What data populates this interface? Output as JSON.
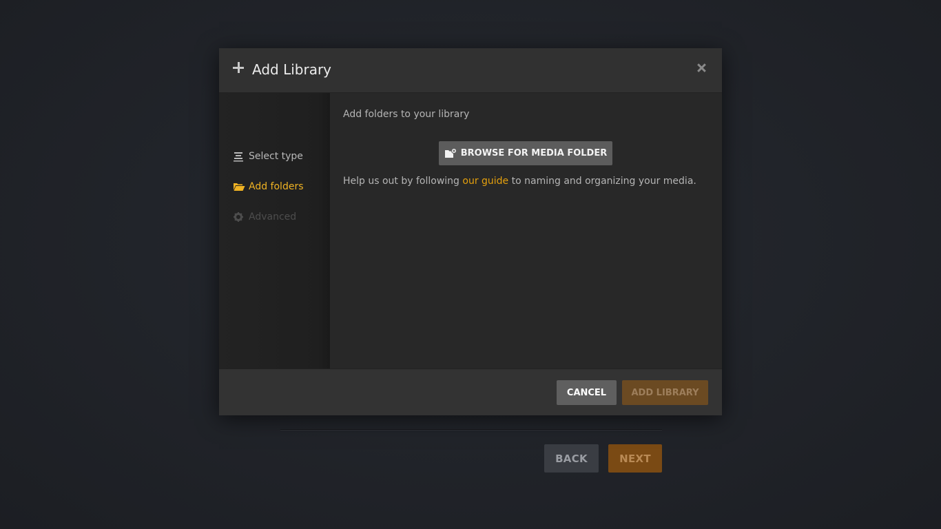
{
  "background": {
    "back_label": "BACK",
    "next_label": "NEXT"
  },
  "modal": {
    "title": "Add Library",
    "sidebar": {
      "items": [
        {
          "label": "Select type",
          "icon": "list-icon",
          "state": "completed"
        },
        {
          "label": "Add folders",
          "icon": "folder-open-icon",
          "state": "active"
        },
        {
          "label": "Advanced",
          "icon": "gear-icon",
          "state": "disabled"
        }
      ]
    },
    "content": {
      "heading": "Add folders to your library",
      "browse_label": "BROWSE FOR MEDIA FOLDER",
      "help_prefix": "Help us out by following ",
      "help_link": "our guide",
      "help_suffix": " to naming and organizing your media."
    },
    "footer": {
      "cancel_label": "CANCEL",
      "add_library_label": "ADD LIBRARY"
    }
  },
  "colors": {
    "accent": "#e5a00d",
    "active_nav": "#f0b323",
    "modal_bg": "#282828",
    "page_bg": "#22252b"
  }
}
